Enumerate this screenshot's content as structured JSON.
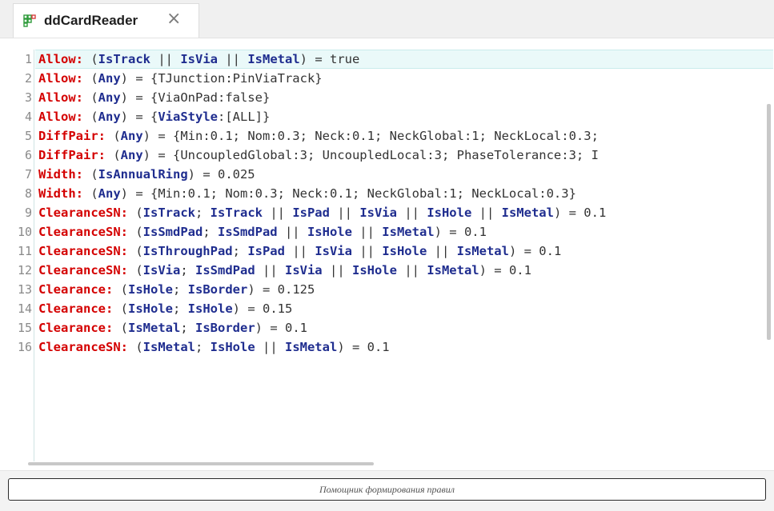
{
  "tab": {
    "title": "ddCardReader",
    "close_glyph": "×",
    "icon": "grid-icon"
  },
  "editor": {
    "lines": [
      {
        "num": "1",
        "parts": [
          [
            "kw",
            "Allow:"
          ],
          [
            "val",
            " ("
          ],
          [
            "cond",
            "IsTrack"
          ],
          [
            "val",
            " || "
          ],
          [
            "cond",
            "IsVia"
          ],
          [
            "val",
            " || "
          ],
          [
            "cond",
            "IsMetal"
          ],
          [
            "val",
            ") = true"
          ]
        ]
      },
      {
        "num": "2",
        "parts": [
          [
            "kw",
            "Allow:"
          ],
          [
            "val",
            " ("
          ],
          [
            "cond",
            "Any"
          ],
          [
            "val",
            ") = {TJunction:PinViaTrack}"
          ]
        ]
      },
      {
        "num": "3",
        "parts": [
          [
            "kw",
            "Allow:"
          ],
          [
            "val",
            " ("
          ],
          [
            "cond",
            "Any"
          ],
          [
            "val",
            ") = {ViaOnPad:false}"
          ]
        ]
      },
      {
        "num": "4",
        "parts": [
          [
            "kw",
            "Allow:"
          ],
          [
            "val",
            " ("
          ],
          [
            "cond",
            "Any"
          ],
          [
            "val",
            ") = {"
          ],
          [
            "cond",
            "ViaStyle"
          ],
          [
            "val",
            ":[ALL]}"
          ]
        ]
      },
      {
        "num": "5",
        "parts": [
          [
            "kw",
            "DiffPair:"
          ],
          [
            "val",
            " ("
          ],
          [
            "cond",
            "Any"
          ],
          [
            "val",
            ") = {Min:0.1; Nom:0.3; Neck:0.1; NeckGlobal:1; NeckLocal:0.3;"
          ]
        ]
      },
      {
        "num": "6",
        "parts": [
          [
            "kw",
            "DiffPair:"
          ],
          [
            "val",
            " ("
          ],
          [
            "cond",
            "Any"
          ],
          [
            "val",
            ") = {UncoupledGlobal:3; UncoupledLocal:3; PhaseTolerance:3; I"
          ]
        ]
      },
      {
        "num": "7",
        "parts": [
          [
            "kw",
            "Width:"
          ],
          [
            "val",
            " ("
          ],
          [
            "cond",
            "IsAnnualRing"
          ],
          [
            "val",
            ") = 0.025"
          ]
        ]
      },
      {
        "num": "8",
        "parts": [
          [
            "kw",
            "Width:"
          ],
          [
            "val",
            " ("
          ],
          [
            "cond",
            "Any"
          ],
          [
            "val",
            ") = {Min:0.1; Nom:0.3; Neck:0.1; NeckGlobal:1; NeckLocal:0.3}"
          ]
        ]
      },
      {
        "num": "9",
        "parts": [
          [
            "kw",
            "ClearanceSN:"
          ],
          [
            "val",
            " ("
          ],
          [
            "cond",
            "IsTrack"
          ],
          [
            "val",
            "; "
          ],
          [
            "cond",
            "IsTrack"
          ],
          [
            "val",
            " || "
          ],
          [
            "cond",
            "IsPad"
          ],
          [
            "val",
            " || "
          ],
          [
            "cond",
            "IsVia"
          ],
          [
            "val",
            " || "
          ],
          [
            "cond",
            "IsHole"
          ],
          [
            "val",
            " || "
          ],
          [
            "cond",
            "IsMetal"
          ],
          [
            "val",
            ") = 0.1"
          ]
        ]
      },
      {
        "num": "10",
        "parts": [
          [
            "kw",
            "ClearanceSN:"
          ],
          [
            "val",
            " ("
          ],
          [
            "cond",
            "IsSmdPad"
          ],
          [
            "val",
            "; "
          ],
          [
            "cond",
            "IsSmdPad"
          ],
          [
            "val",
            " || "
          ],
          [
            "cond",
            "IsHole"
          ],
          [
            "val",
            " || "
          ],
          [
            "cond",
            "IsMetal"
          ],
          [
            "val",
            ") = 0.1"
          ]
        ]
      },
      {
        "num": "11",
        "parts": [
          [
            "kw",
            "ClearanceSN:"
          ],
          [
            "val",
            " ("
          ],
          [
            "cond",
            "IsThroughPad"
          ],
          [
            "val",
            "; "
          ],
          [
            "cond",
            "IsPad"
          ],
          [
            "val",
            " || "
          ],
          [
            "cond",
            "IsVia"
          ],
          [
            "val",
            " || "
          ],
          [
            "cond",
            "IsHole"
          ],
          [
            "val",
            " || "
          ],
          [
            "cond",
            "IsMetal"
          ],
          [
            "val",
            ") = 0.1"
          ]
        ]
      },
      {
        "num": "12",
        "parts": [
          [
            "kw",
            "ClearanceSN:"
          ],
          [
            "val",
            " ("
          ],
          [
            "cond",
            "IsVia"
          ],
          [
            "val",
            "; "
          ],
          [
            "cond",
            "IsSmdPad"
          ],
          [
            "val",
            " || "
          ],
          [
            "cond",
            "IsVia"
          ],
          [
            "val",
            " || "
          ],
          [
            "cond",
            "IsHole"
          ],
          [
            "val",
            " || "
          ],
          [
            "cond",
            "IsMetal"
          ],
          [
            "val",
            ") = 0.1"
          ]
        ]
      },
      {
        "num": "13",
        "parts": [
          [
            "kw",
            "Clearance:"
          ],
          [
            "val",
            " ("
          ],
          [
            "cond",
            "IsHole"
          ],
          [
            "val",
            "; "
          ],
          [
            "cond",
            "IsBorder"
          ],
          [
            "val",
            ") = 0.125"
          ]
        ]
      },
      {
        "num": "14",
        "parts": [
          [
            "kw",
            "Clearance:"
          ],
          [
            "val",
            " ("
          ],
          [
            "cond",
            "IsHole"
          ],
          [
            "val",
            "; "
          ],
          [
            "cond",
            "IsHole"
          ],
          [
            "val",
            ") = 0.15"
          ]
        ]
      },
      {
        "num": "15",
        "parts": [
          [
            "kw",
            "Clearance:"
          ],
          [
            "val",
            " ("
          ],
          [
            "cond",
            "IsMetal"
          ],
          [
            "val",
            "; "
          ],
          [
            "cond",
            "IsBorder"
          ],
          [
            "val",
            ") = 0.1"
          ]
        ]
      },
      {
        "num": "16",
        "parts": [
          [
            "kw",
            "ClearanceSN:"
          ],
          [
            "val",
            " ("
          ],
          [
            "cond",
            "IsMetal"
          ],
          [
            "val",
            "; "
          ],
          [
            "cond",
            "IsHole"
          ],
          [
            "val",
            " || "
          ],
          [
            "cond",
            "IsMetal"
          ],
          [
            "val",
            ") = 0.1"
          ]
        ]
      }
    ]
  },
  "helper": {
    "label": "Помощник формирования правил"
  },
  "colors": {
    "keyword": "#d40000",
    "condition": "#1f2d8f",
    "value": "#333333",
    "current_line": "#eaf9f9"
  }
}
